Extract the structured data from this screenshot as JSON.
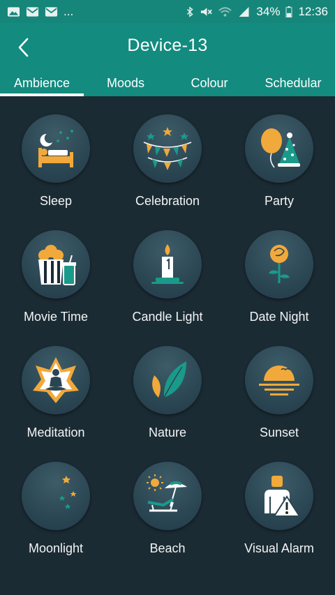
{
  "status": {
    "battery": "34%",
    "time": "12:36",
    "more": "..."
  },
  "header": {
    "title": "Device-13"
  },
  "tabs": [
    {
      "label": "Ambience"
    },
    {
      "label": "Moods"
    },
    {
      "label": "Colour"
    },
    {
      "label": "Schedular"
    }
  ],
  "ambiences": [
    {
      "label": "Sleep",
      "icon": "sleep-icon"
    },
    {
      "label": "Celebration",
      "icon": "celebration-icon"
    },
    {
      "label": "Party",
      "icon": "party-icon"
    },
    {
      "label": "Movie Time",
      "icon": "movie-time-icon"
    },
    {
      "label": "Candle Light",
      "icon": "candle-light-icon"
    },
    {
      "label": "Date Night",
      "icon": "date-night-icon"
    },
    {
      "label": "Meditation",
      "icon": "meditation-icon"
    },
    {
      "label": "Nature",
      "icon": "nature-icon"
    },
    {
      "label": "Sunset",
      "icon": "sunset-icon"
    },
    {
      "label": "Moonlight",
      "icon": "moonlight-icon"
    },
    {
      "label": "Beach",
      "icon": "beach-icon"
    },
    {
      "label": "Visual Alarm",
      "icon": "visual-alarm-icon"
    }
  ],
  "colors": {
    "accent": "#138b7f",
    "background": "#1b2b33",
    "icon_orange": "#f2a93b",
    "icon_teal": "#1a9a8a"
  }
}
